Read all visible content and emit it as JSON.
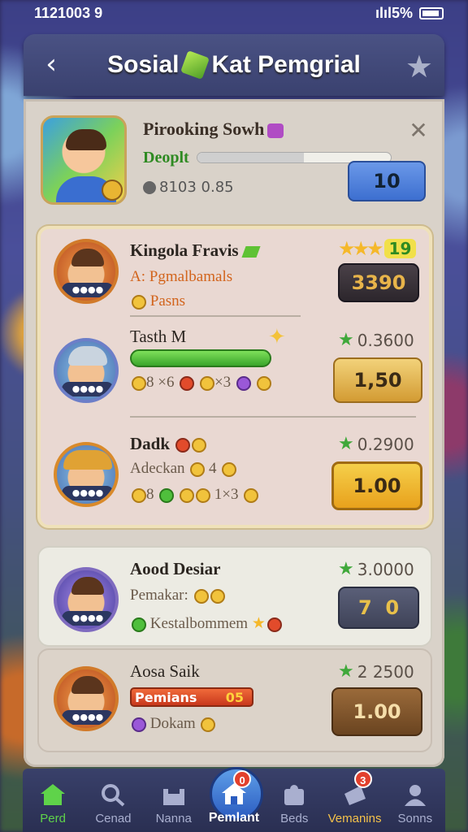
{
  "status_bar": {
    "time": "1121003 9",
    "signal_battery": "ılıl5%"
  },
  "header": {
    "title_left": "Sosial",
    "title_right": "Kat Pemgrial"
  },
  "top_card": {
    "name": "Pirooking Sowh",
    "progress_label": "Deoplt",
    "progress_value": 0.55,
    "score": "8103 0.85",
    "button_value": "10"
  },
  "friends": [
    {
      "name": "Kingola Fravis",
      "sub1": "A: Pgmalbamals",
      "sub2": "Pasns",
      "points": "19",
      "button_value": "3390"
    },
    {
      "name": "Tasth M",
      "bar_value": 0.8,
      "chips": "8 ×6",
      "chips2": "×3",
      "points": "0.3600",
      "button_value": "1,50"
    },
    {
      "name": "Dadk",
      "sub1": "Adeckan",
      "sub1_num": "4",
      "chips": "8",
      "chips2": "1×3",
      "points": "0.2900",
      "button_value": "1.00"
    },
    {
      "name": "Aood Desiar",
      "sub1": "Pemakar:",
      "sub2": "Kestalbommem",
      "points": "3.0000",
      "button_value": "7  0"
    },
    {
      "name": "Aosa Saik",
      "bar_label": "Pemians",
      "bar_num": "05",
      "sub2": "Dokam",
      "points": "2 2500",
      "button_value": "1.00"
    }
  ],
  "nav": {
    "items": [
      {
        "label": "Perd",
        "badge": ""
      },
      {
        "label": "Cenad",
        "badge": ""
      },
      {
        "label": "Nanna",
        "badge": ""
      },
      {
        "label": "Pemlant",
        "badge": "0"
      },
      {
        "label": "Beds",
        "badge": ""
      },
      {
        "label": "Vemanins",
        "badge": "3"
      },
      {
        "label": "Sonns",
        "badge": ""
      }
    ]
  },
  "colors": {
    "accent_blue": "#3d6fd0",
    "accent_green": "#3fa83a",
    "accent_gold": "#e8a11c"
  }
}
